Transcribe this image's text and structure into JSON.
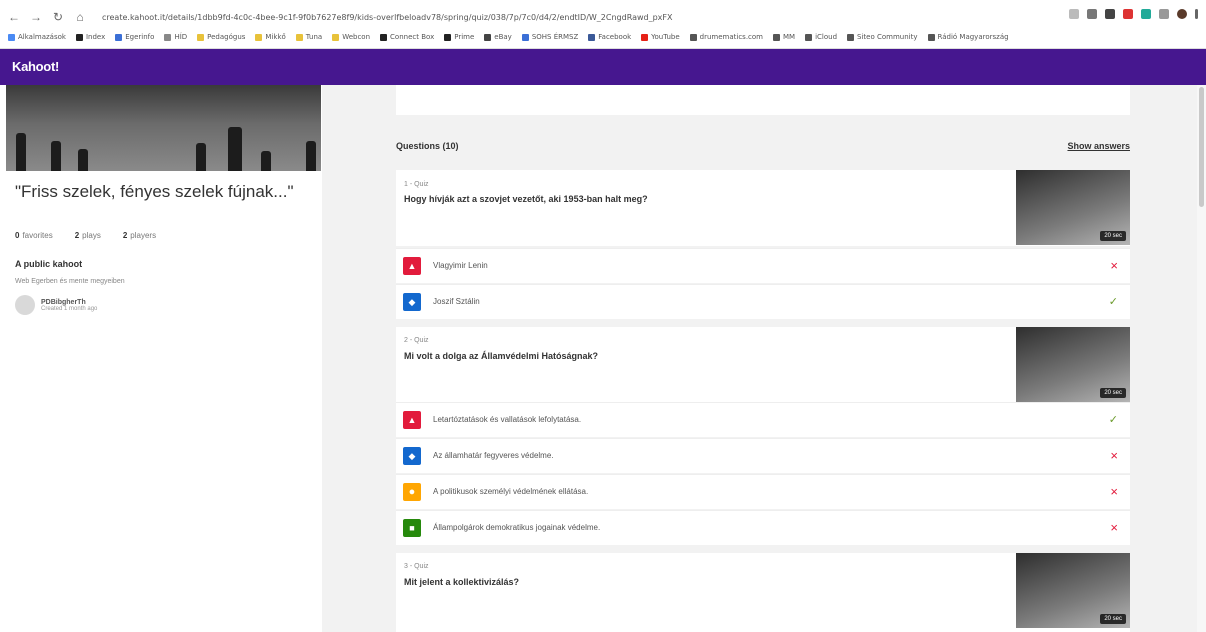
{
  "browser": {
    "url": "create.kahoot.it/details/1dbb9fd-4c0c-4bee-9c1f-9f0b7627e8f9/kids-overlfbeloadv78/spring/quiz/038/7p/7c0/d4/2/endtID/W_2CngdRawd_pxFX",
    "bookmarks": [
      {
        "label": "Alkalmazások",
        "color": "#4a8af4"
      },
      {
        "label": "Index",
        "color": "#222222"
      },
      {
        "label": "Egerinfo",
        "color": "#3b6fd6"
      },
      {
        "label": "HÍD",
        "color": "#888888"
      },
      {
        "label": "Pedagógus",
        "color": "#e8c23a"
      },
      {
        "label": "Mikkő",
        "color": "#e8c23a"
      },
      {
        "label": "Tuna",
        "color": "#e8c23a"
      },
      {
        "label": "Webcon",
        "color": "#e8c23a"
      },
      {
        "label": "Connect Box",
        "color": "#222222"
      },
      {
        "label": "Prime",
        "color": "#222222"
      },
      {
        "label": "eBay",
        "color": "#444444"
      },
      {
        "label": "SOHS ÉRMSZ",
        "color": "#3b6fd6"
      },
      {
        "label": "Facebook",
        "color": "#3b5998"
      },
      {
        "label": "YouTube",
        "color": "#e62117"
      },
      {
        "label": "drumematics.com",
        "color": "#555555"
      },
      {
        "label": "MM",
        "color": "#555555"
      },
      {
        "label": "iCloud",
        "color": "#555555"
      },
      {
        "label": "Siteo Community",
        "color": "#555555"
      },
      {
        "label": "Rádió Magyarország",
        "color": "#555555"
      }
    ]
  },
  "app": {
    "logo": "Kahoot!",
    "brand_color": "#46178f"
  },
  "kahoot": {
    "title": "\"Friss szelek, fényes szelek fújnak...\"",
    "favorites_count": "0",
    "favorites_label": "favorites",
    "plays_count": "2",
    "plays_label": "plays",
    "players_count": "2",
    "players_label": "players",
    "visibility": "A public kahoot",
    "description": "Web Egerben és mente megyeiben",
    "creator_name": "PDBibgherTh",
    "created": "Created 1 month ago"
  },
  "questions_header": {
    "count_label": "Questions (10)",
    "show_answers": "Show answers"
  },
  "questions": [
    {
      "label": "1 - Quiz",
      "text": "Hogy hívják azt a szovjet vezetőt, aki 1953-ban halt meg?",
      "time": "20 sec",
      "answers": [
        {
          "shape": "triangle",
          "color": "#e21b3c",
          "text": "Vlagyimir Lenin",
          "correct": false
        },
        {
          "shape": "diamond",
          "color": "#1368ce",
          "text": "Joszif Sztálin",
          "correct": true
        }
      ]
    },
    {
      "label": "2 - Quiz",
      "text": "Mi volt a dolga az Államvédelmi Hatóságnak?",
      "time": "20 sec",
      "answers": [
        {
          "shape": "triangle",
          "color": "#e21b3c",
          "text": "Letartóztatások és vallatások lefolytatása.",
          "correct": true
        },
        {
          "shape": "diamond",
          "color": "#1368ce",
          "text": "Az államhatár fegyveres védelme.",
          "correct": false
        },
        {
          "shape": "circle",
          "color": "#ffa602",
          "text": "A politikusok személyi védelmének ellátása.",
          "correct": false
        },
        {
          "shape": "square",
          "color": "#26890c",
          "text": "Állampolgárok demokratikus jogainak védelme.",
          "correct": false
        }
      ]
    },
    {
      "label": "3 - Quiz",
      "text": "Mit jelent a kollektivizálás?",
      "time": "20 sec",
      "answers": []
    }
  ],
  "icons": {
    "wrong": "×",
    "correct": "✓",
    "triangle": "▲",
    "diamond": "◆",
    "circle": "●",
    "square": "■"
  }
}
